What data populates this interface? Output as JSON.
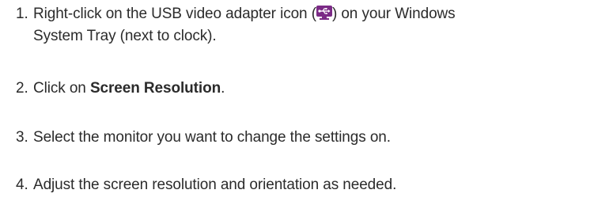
{
  "steps": [
    {
      "number": "1.",
      "text_before": "Right-click on the USB video adapter icon (",
      "icon": "usb-video-adapter-icon",
      "text_after": ") on your Windows",
      "continuation": "System Tray (next to clock)."
    },
    {
      "number": "2.",
      "text_before": "Click on ",
      "bold": "Screen Resolution",
      "text_after": "."
    },
    {
      "number": "3.",
      "text": "Select the monitor you want to change the settings on."
    },
    {
      "number": "4.",
      "text": "Adjust the screen resolution and orientation as needed."
    }
  ],
  "colors": {
    "text": "#2b2b2b",
    "icon_purple": "#7b2a86"
  }
}
